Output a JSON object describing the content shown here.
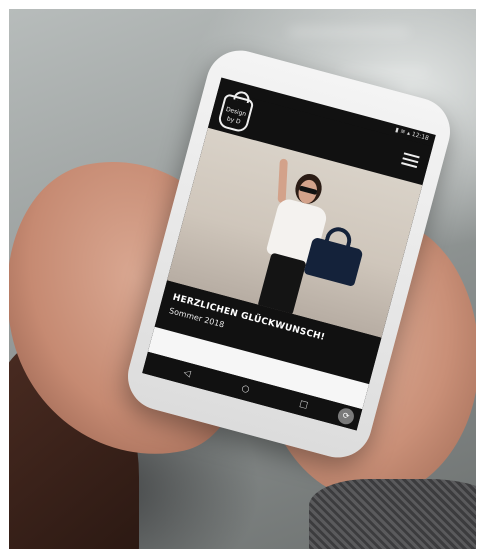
{
  "screen": {
    "statusbar": "▮ ≋ ▴ 12:18",
    "logo_text": "Design by D",
    "hero_caption": {
      "title": "HERZLICHEN GLÜCKWUNSCH!",
      "subtitle": "Sommer 2018"
    },
    "nav": {
      "back_icon": "◁",
      "home_icon": "○",
      "recents_icon": "□"
    },
    "fab_icon": "⟳"
  },
  "colors": {
    "screen_bg": "#111111",
    "hero_bg": "#d9d2c8",
    "bag": "#14223a"
  }
}
